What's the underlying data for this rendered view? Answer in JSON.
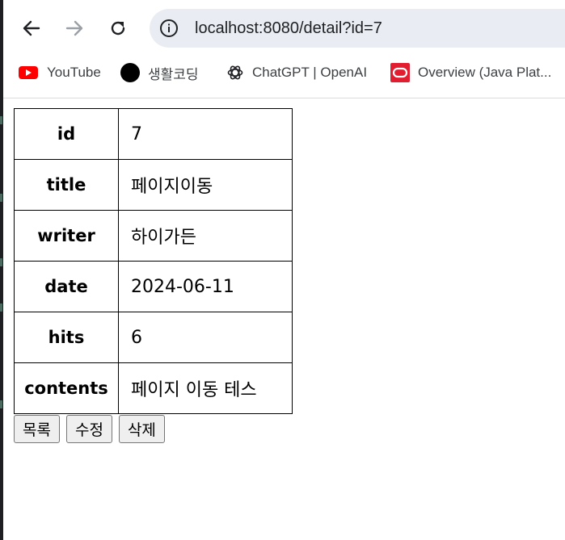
{
  "browser": {
    "url": "localhost:8080/detail?id=7",
    "back_icon": "arrow-left-icon",
    "forward_icon": "arrow-right-icon",
    "reload_icon": "reload-icon",
    "site_info_icon": "tune-icon",
    "bookmarks": [
      {
        "label": "YouTube",
        "icon": "youtube-icon",
        "color": "#ff0000"
      },
      {
        "label": "생활코딩",
        "icon": "black-circle-icon",
        "color": "#000000"
      },
      {
        "label": "ChatGPT | OpenAI",
        "icon": "openai-icon",
        "color": "#202124"
      },
      {
        "label": "Overview (Java Plat...",
        "icon": "oracle-icon",
        "color": "#e11d2f"
      }
    ]
  },
  "detail": {
    "rows": [
      {
        "key": "id",
        "value": "7"
      },
      {
        "key": "title",
        "value": "페이지이동"
      },
      {
        "key": "writer",
        "value": "하이가든"
      },
      {
        "key": "date",
        "value": "2024-06-11"
      },
      {
        "key": "hits",
        "value": "6"
      },
      {
        "key": "contents",
        "value": "페이지 이동 테스"
      }
    ]
  },
  "actions": {
    "list_label": "목록",
    "edit_label": "수정",
    "delete_label": "삭제"
  }
}
